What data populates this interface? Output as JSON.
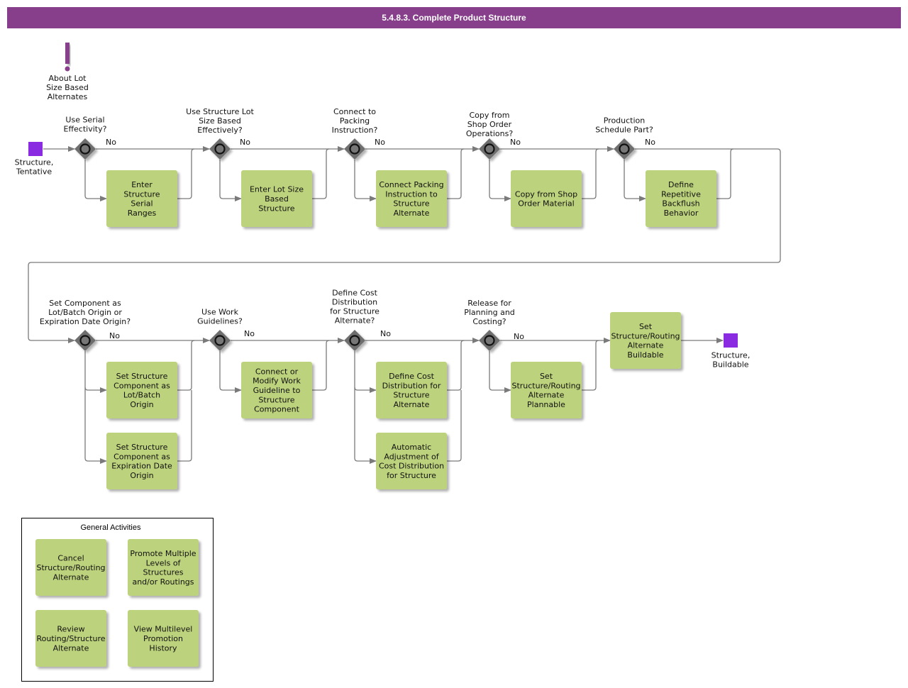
{
  "title": "5.4.8.3. Complete Product Structure",
  "colors": {
    "title_bar": "#873f8b",
    "task_fill": "#bcd27c",
    "event_fill": "#8a2be2",
    "gateway_fill": "#6e6e6e",
    "annotation_icon": "#873f8b",
    "flow_line": "#7a7a7a"
  },
  "annotation": {
    "icon": "exclamation-icon",
    "label": [
      "About Lot",
      "Size Based",
      "Alternates"
    ]
  },
  "start_event": {
    "label": [
      "Structure,",
      "Tentative"
    ]
  },
  "end_event": {
    "label": [
      "Structure,",
      "Buildable"
    ]
  },
  "gateways": [
    {
      "id": "g1",
      "question": [
        "Use Serial",
        "Effectivity?"
      ],
      "branch_label": "No"
    },
    {
      "id": "g2",
      "question": [
        "Use Structure Lot",
        "Size Based",
        "Effectively?"
      ],
      "branch_label": "No"
    },
    {
      "id": "g3",
      "question": [
        "Connect to",
        "Packing",
        "Instruction?"
      ],
      "branch_label": "No"
    },
    {
      "id": "g4",
      "question": [
        "Copy from",
        "Shop Order",
        "Operations?"
      ],
      "branch_label": "No"
    },
    {
      "id": "g5",
      "question": [
        "Production",
        "Schedule Part?"
      ],
      "branch_label": "No"
    },
    {
      "id": "g6",
      "question": [
        "Set Component as",
        "Lot/Batch Origin or",
        "Expiration Date Origin?"
      ],
      "branch_label": "No"
    },
    {
      "id": "g7",
      "question": [
        "Use Work",
        "Guidelines?"
      ],
      "branch_label": "No"
    },
    {
      "id": "g8",
      "question": [
        "Define Cost",
        "Distribution",
        "for Structure",
        "Alternate?"
      ],
      "branch_label": "No"
    },
    {
      "id": "g9",
      "question": [
        "Release for",
        "Planning and",
        "Costing?"
      ],
      "branch_label": "No"
    }
  ],
  "tasks": [
    {
      "id": "t1",
      "label": [
        "Enter",
        "Structure",
        "Serial",
        "Ranges"
      ]
    },
    {
      "id": "t2",
      "label": [
        "Enter Lot Size",
        "Based",
        "Structure"
      ]
    },
    {
      "id": "t3",
      "label": [
        "Connect Packing",
        "Instruction to",
        "Structure",
        "Alternate"
      ]
    },
    {
      "id": "t4",
      "label": [
        "Copy from Shop",
        "Order Material"
      ]
    },
    {
      "id": "t5",
      "label": [
        "Define",
        "Repetitive",
        "Backflush",
        "Behavior"
      ]
    },
    {
      "id": "t6",
      "label": [
        "Set Structure",
        "Component as",
        "Lot/Batch",
        "Origin"
      ]
    },
    {
      "id": "t7",
      "label": [
        "Set Structure",
        "Component as",
        "Expiration Date",
        "Origin"
      ]
    },
    {
      "id": "t8",
      "label": [
        "Connect or",
        "Modify Work",
        "Guideline to",
        "Structure",
        "Component"
      ]
    },
    {
      "id": "t9",
      "label": [
        "Define Cost",
        "Distribution for",
        "Structure",
        "Alternate"
      ]
    },
    {
      "id": "t10",
      "label": [
        "Automatic",
        "Adjustment of",
        "Cost Distribution",
        "for Structure"
      ]
    },
    {
      "id": "t11",
      "label": [
        "Set",
        "Structure/Routing",
        "Alternate",
        "Plannable"
      ]
    },
    {
      "id": "t12",
      "label": [
        "Set",
        "Structure/Routing",
        "Alternate",
        "Buildable"
      ]
    }
  ],
  "general_activities": {
    "title": "General Activities",
    "items": [
      {
        "id": "ga1",
        "label": [
          "Cancel",
          "Structure/Routing",
          "Alternate"
        ]
      },
      {
        "id": "ga2",
        "label": [
          "Promote Multiple",
          "Levels of",
          "Structures",
          "and/or Routings"
        ]
      },
      {
        "id": "ga3",
        "label": [
          "Review",
          "Routing/Structure",
          "Alternate"
        ]
      },
      {
        "id": "ga4",
        "label": [
          "View Multilevel",
          "Promotion",
          "History"
        ]
      }
    ]
  }
}
